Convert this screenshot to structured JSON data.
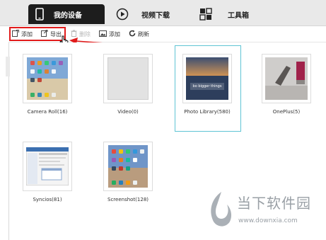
{
  "nav": {
    "tabs": [
      {
        "label": "我的设备",
        "icon": "phone-icon"
      },
      {
        "label": "视频下载",
        "icon": "play-icon"
      },
      {
        "label": "工具箱",
        "icon": "toolbox-icon"
      }
    ]
  },
  "toolbar": {
    "add_label": "添加",
    "export_label": "导出",
    "delete_label": "删除",
    "add_photo_label": "添加",
    "refresh_label": "刷新"
  },
  "albums": [
    {
      "name": "Camera Roll(16)"
    },
    {
      "name": "Video(0)"
    },
    {
      "name": "Photo Library(580)",
      "overlay_text": "bo bigger things"
    },
    {
      "name": "OnePlus(5)"
    },
    {
      "name": "Syncios(81)"
    },
    {
      "name": "Screenshot(128)"
    }
  ],
  "watermark": {
    "title": "当下软件园",
    "url": "www.downxia.com"
  },
  "colors": {
    "highlight": "#e11b1b",
    "selection": "#5fc4d4",
    "active_tab": "#1d1d1d"
  }
}
